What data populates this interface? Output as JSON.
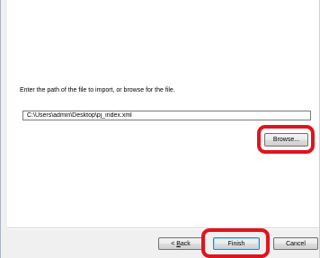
{
  "dialog": {
    "instruction": "Enter the path of the file to import, or browse for the file.",
    "file_path": {
      "value": "C:\\Users\\admin\\Desktop\\pj_index.xml",
      "placeholder": ""
    },
    "browse_label": "Browse..."
  },
  "footer": {
    "back_label": "< Back",
    "finish_label": "Finish",
    "cancel_label": "Cancel"
  },
  "colors": {
    "highlight": "#e0141e",
    "panel": "#ffffff",
    "chrome": "#f0f0f0",
    "default_button_border": "#3c7fb1"
  },
  "annotations": {
    "highlighted_controls": [
      "browse-button",
      "finish-button"
    ]
  }
}
